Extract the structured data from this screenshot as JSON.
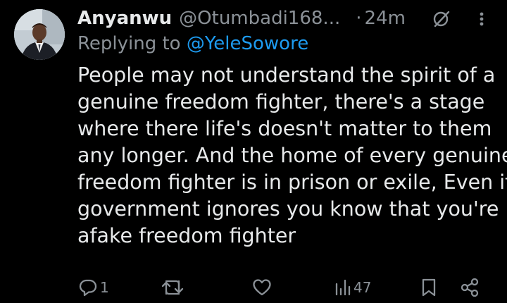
{
  "post": {
    "author_name": "Anyanwu",
    "author_handle": "@Otumbadi168...",
    "separator": "·",
    "time": "24m",
    "replying_prefix": "Replying to",
    "replying_to": "@YeleSowore",
    "body_lines": [
      "People may not understand the spirit of a",
      "genuine freedom fighter, there's a stage",
      "where there life's doesn't matter to them",
      "any longer. And the home of every genuine",
      "freedom fighter is in prison or exile, Even if",
      "government ignores you know that you're",
      "afake freedom fighter"
    ]
  },
  "actions": {
    "reply_count": "1",
    "views_count": "47"
  },
  "icons": {
    "avatar": "avatar",
    "grok": "grok-icon",
    "more": "more-icon",
    "reply": "reply-icon",
    "repost": "repost-icon",
    "like": "heart-icon",
    "views": "views-icon",
    "bookmark": "bookmark-icon",
    "share": "share-icon"
  },
  "colors": {
    "background": "#000000",
    "text": "#e7e9ea",
    "secondary": "#8b9197",
    "link": "#1d9bf0"
  }
}
